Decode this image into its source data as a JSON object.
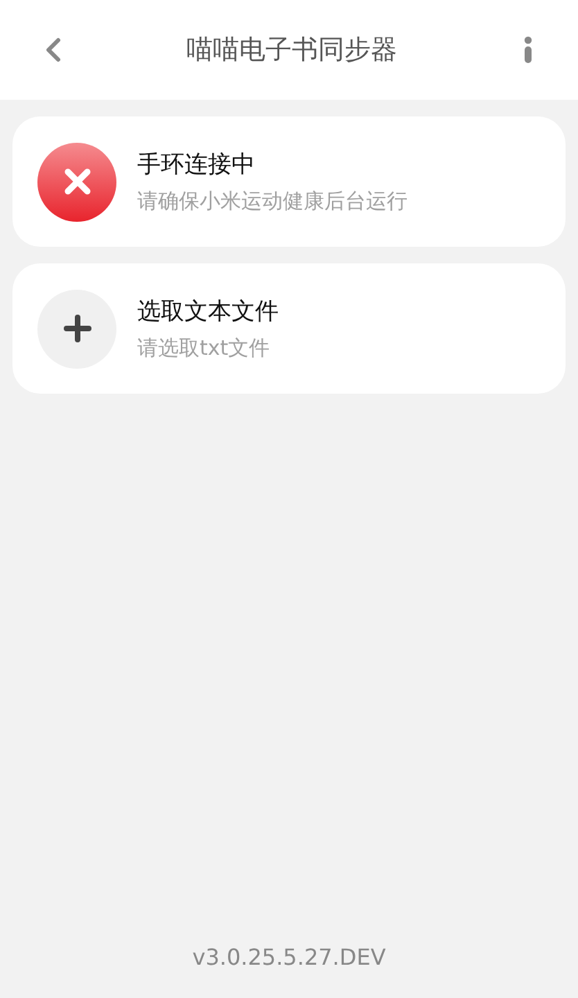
{
  "header": {
    "title": "喵喵电子书同步器"
  },
  "cards": [
    {
      "kind": "error",
      "title": "手环连接中",
      "subtitle": "请确保小米运动健康后台运行"
    },
    {
      "kind": "add",
      "title": "选取文本文件",
      "subtitle": "请选取txt文件"
    }
  ],
  "version": "v3.0.25.5.27.DEV"
}
